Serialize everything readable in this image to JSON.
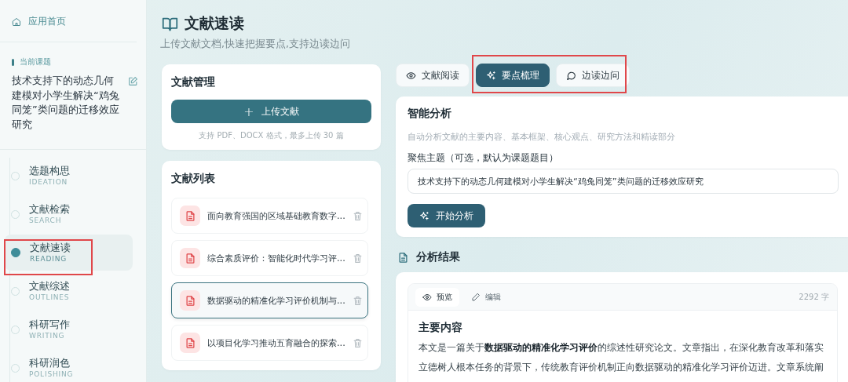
{
  "sidebar": {
    "home_link": "应用首页",
    "topic_label": "当前课题",
    "topic": "技术支持下的动态几何建模对小学生解决“鸡兔同笼”类问题的迁移效应研究",
    "nav": [
      {
        "title": "选题构思",
        "subtitle": "IDEATION",
        "selected": false
      },
      {
        "title": "文献检索",
        "subtitle": "SEARCH",
        "selected": false
      },
      {
        "title": "文献速读",
        "subtitle": "READING",
        "selected": true
      },
      {
        "title": "文献综述",
        "subtitle": "OUTLINES",
        "selected": false
      },
      {
        "title": "科研写作",
        "subtitle": "WRITING",
        "selected": false
      },
      {
        "title": "科研润色",
        "subtitle": "POLISHING",
        "selected": false
      }
    ]
  },
  "header": {
    "title": "文献速读",
    "subtitle": "上传文献文档,快速把握要点,支持边读边问"
  },
  "manage": {
    "title": "文献管理",
    "upload_button": "上传文献",
    "upload_icon": "+",
    "hint": "支持 PDF、DOCX 格式，最多上传 30 篇"
  },
  "list": {
    "title": "文献列表",
    "items": [
      {
        "title": "面向教育强国的区域基础教育数字...",
        "selected": false
      },
      {
        "title": "综合素质评价：智能化时代学习评...",
        "selected": false
      },
      {
        "title": "数据驱动的精准化学习评价机制与...",
        "selected": true
      },
      {
        "title": "以项目化学习推动五育融合的探索...",
        "selected": false
      }
    ]
  },
  "tabs": [
    {
      "label": "文献阅读",
      "kind": "eye",
      "selected": false
    },
    {
      "label": "要点梳理",
      "kind": "sparkle",
      "selected": true
    },
    {
      "label": "边读边问",
      "kind": "chat",
      "selected": false
    }
  ],
  "analysis": {
    "title": "智能分析",
    "description": "自动分析文献的主要内容、基本框架、核心观点、研究方法和精读部分",
    "focus_label": "聚焦主题（可选，默认为课题题目）",
    "focus_value": "技术支持下的动态几何建模对小学生解决“鸡兔同笼”类问题的迁移效应研究",
    "start_button": "开始分析"
  },
  "result": {
    "title": "分析结果",
    "modes": [
      {
        "label": "预览",
        "kind": "eye",
        "selected": true
      },
      {
        "label": "编辑",
        "kind": "pencil",
        "selected": false
      }
    ],
    "word_count": "2292 字",
    "section_title": "主要内容",
    "paragraph": "本文是一篇关于**数据驱动的精准化学习评价**的综述性研究论文。文章指出，在深化教育改革和落实立德树人根本任务的背景下，传统教育评价机制正向数据驱动的精准化学习评价迈进。文章系统阐"
  }
}
